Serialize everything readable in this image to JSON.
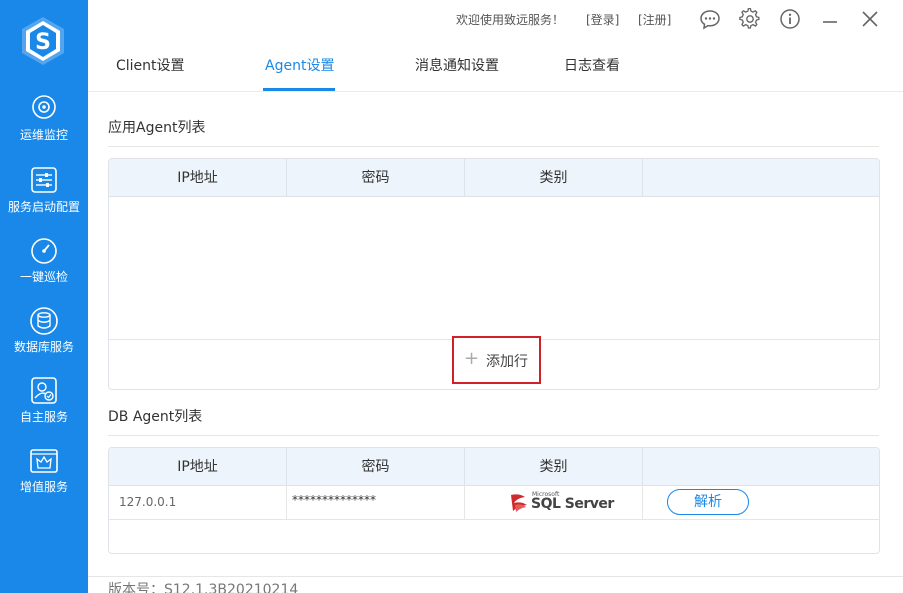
{
  "sidebar": {
    "items": [
      {
        "label": "运维监控",
        "icon": "camera-monitor-icon"
      },
      {
        "label": "服务启动配置",
        "icon": "sliders-icon"
      },
      {
        "label": "一键巡检",
        "icon": "gauge-icon"
      },
      {
        "label": "数据库服务",
        "icon": "database-icon"
      },
      {
        "label": "自主服务",
        "icon": "user-check-icon"
      },
      {
        "label": "增值服务",
        "icon": "crown-icon"
      }
    ]
  },
  "header": {
    "welcome": "欢迎使用致远服务！",
    "login": "[登录]",
    "register": "[注册]"
  },
  "tabs": [
    {
      "label": "Client设置"
    },
    {
      "label": "Agent设置"
    },
    {
      "label": "消息通知设置"
    },
    {
      "label": "日志查看"
    }
  ],
  "app_agents": {
    "title": "应用Agent列表",
    "columns": [
      "IP地址",
      "密码",
      "类别",
      ""
    ],
    "rows": [],
    "add_row_label": "添加行"
  },
  "db_agents": {
    "title": "DB Agent列表",
    "columns": [
      "IP地址",
      "密码",
      "类别",
      ""
    ],
    "rows": [
      {
        "ip": "127.0.0.1",
        "password": "**************",
        "type_logo_small": "Microsoft",
        "type_logo_main": "SQL Server",
        "action": "解析"
      }
    ]
  },
  "footer": {
    "version": "版本号：S12.1.3B20210214"
  },
  "colors": {
    "brand": "#1a88e8",
    "highlight": "#d0212b"
  }
}
